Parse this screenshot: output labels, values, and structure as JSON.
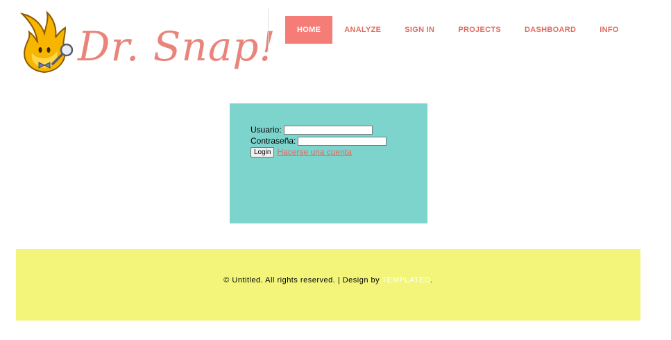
{
  "brand": {
    "logo_text": "Dr. Snap!"
  },
  "nav": {
    "items": [
      {
        "label": "HOME"
      },
      {
        "label": "ANALYZE"
      },
      {
        "label": "SIGN IN"
      },
      {
        "label": "PROJECTS"
      },
      {
        "label": "DASHBOARD"
      },
      {
        "label": "INFO"
      }
    ],
    "active": "HOME"
  },
  "login": {
    "user_label": "Usuario:",
    "user_value": "",
    "password_label": "Contraseña:",
    "password_value": "",
    "login_button": "Login",
    "signup_link": "Hacerse una cuenta"
  },
  "footer": {
    "text_before": "© Untitled. All rights reserved. | Design by ",
    "link": "TEMPLATED",
    "text_after": "."
  },
  "colors": {
    "nav_active_bg": "#f67c77",
    "nav_text": "#e06a5f",
    "login_panel_bg": "#7dd4cd",
    "footer_bg": "#f2f57a",
    "logo_text": "#e8847a"
  }
}
